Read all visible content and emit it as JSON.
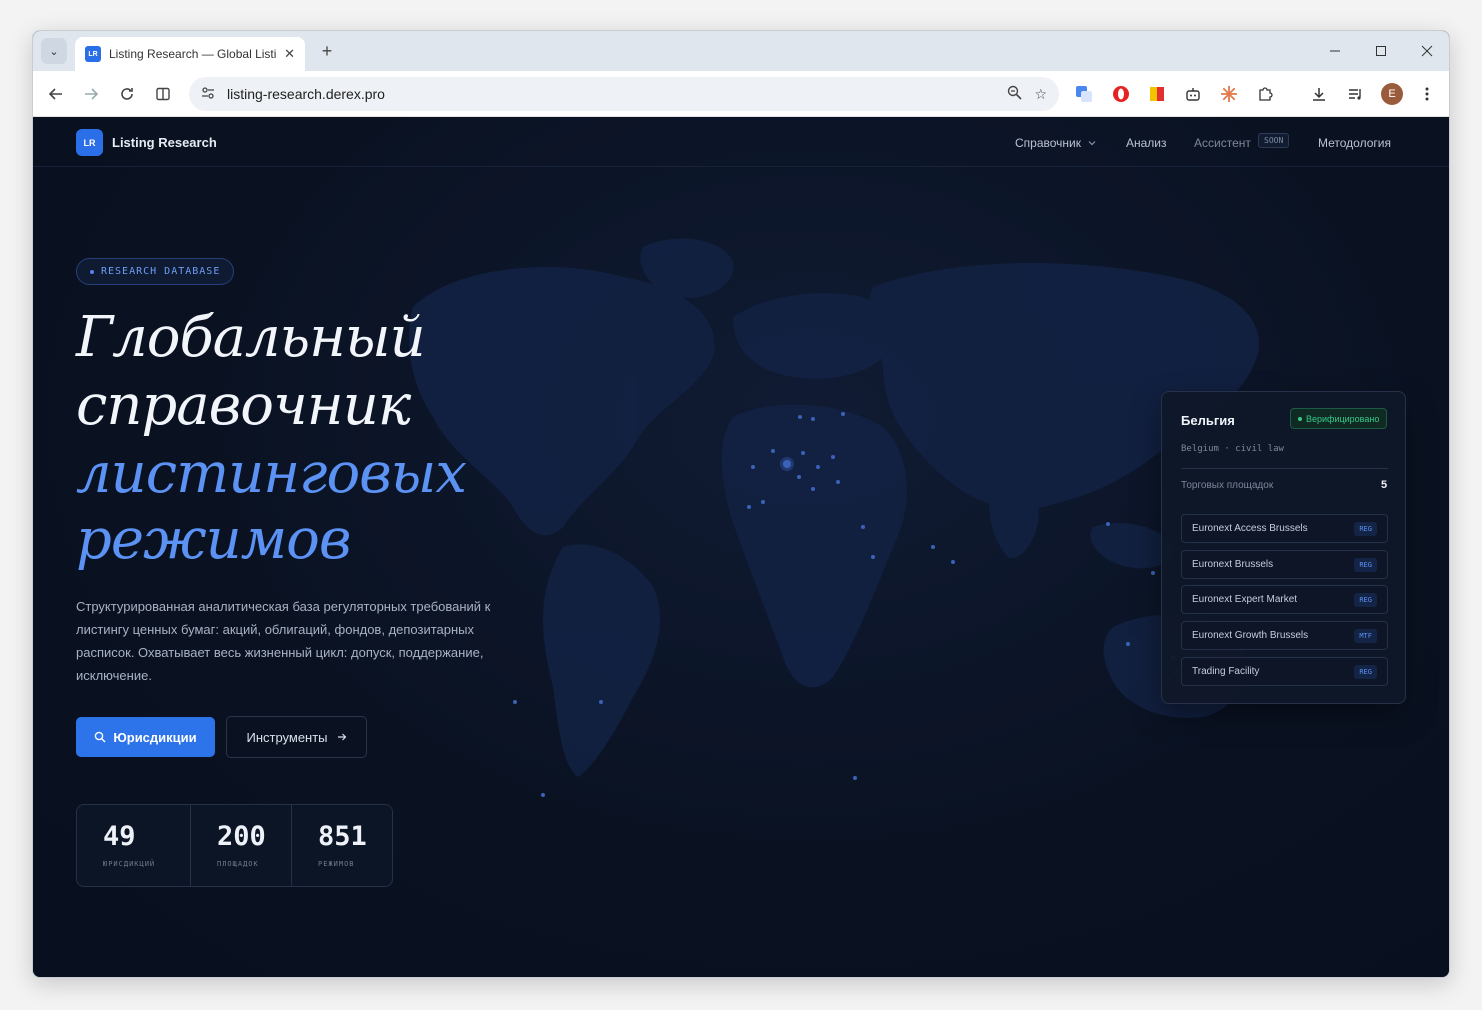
{
  "browser": {
    "tab_title": "Listing Research — Global Listin",
    "tab_close": "✕",
    "new_tab": "+",
    "url": "listing-research.derex.pro",
    "favicon_text": "LR",
    "profile_initial": "E"
  },
  "site": {
    "logo_abbr": "LR",
    "logo_name": "Listing Research",
    "nav": {
      "reference": "Справочник",
      "analysis": "Анализ",
      "assistant": "Ассистент",
      "assistant_badge": "SOON",
      "methodology": "Методология"
    }
  },
  "hero": {
    "badge": "RESEARCH DATABASE",
    "title_line1": "Глобальный",
    "title_line2": "справочник",
    "title_line3": "листинговых",
    "title_line4": "режимов",
    "description": "Структурированная аналитическая база регуляторных требований к листингу ценных бумаг: акций, облигаций, фондов, депозитарных расписок. Охватывает весь жизненный цикл: допуск, поддержание, исключение.",
    "primary_button": "Юрисдикции",
    "secondary_button": "Инструменты"
  },
  "stats": [
    {
      "value": "49",
      "label": "ЮРИСДИКЦИЙ"
    },
    {
      "value": "200",
      "label": "ПЛОЩАДОК"
    },
    {
      "value": "851",
      "label": "РЕЖИМОВ"
    }
  ],
  "card": {
    "title": "Бельгия",
    "status": "Верифицировано",
    "subtitle": "Belgium · civil law",
    "count_label": "Торговых площадок",
    "count": "5",
    "venues": [
      {
        "name": "Euronext Access Brussels",
        "tag": "REG"
      },
      {
        "name": "Euronext Brussels",
        "tag": "REG"
      },
      {
        "name": "Euronext Expert Market",
        "tag": "REG"
      },
      {
        "name": "Euronext Growth Brussels",
        "tag": "MTF"
      },
      {
        "name": "Trading Facility",
        "tag": "REG"
      }
    ]
  },
  "colors": {
    "accent": "#2d73ea",
    "accent_text": "#5b92f3",
    "background": "#0a1120",
    "verified": "#36c98b"
  },
  "icons": {
    "search": "search-icon",
    "arrow_right": "arrow-right-icon",
    "chevron_down": "chevron-down-icon"
  }
}
